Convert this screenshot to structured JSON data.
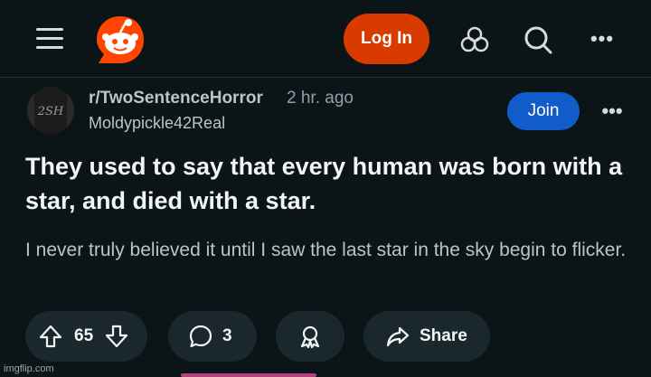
{
  "header": {
    "login_label": "Log In",
    "icons": [
      "menu-icon",
      "reddit-logo",
      "communities-icon",
      "search-icon",
      "more-options-icon"
    ],
    "brand_color": "#d93a00"
  },
  "post": {
    "subreddit": "r/TwoSentenceHorror",
    "time_ago": "2 hr. ago",
    "author": "Moldypickle42Real",
    "avatar_text": "2SH",
    "join_label": "Join",
    "title": "They used to say that every human was born with a star, and died with a star.",
    "body": "I never truly believed it until I saw the last star in the sky begin to flicker.",
    "upvotes": "65",
    "comments": "3",
    "share_label": "Share"
  },
  "watermark": "imgflip.com"
}
